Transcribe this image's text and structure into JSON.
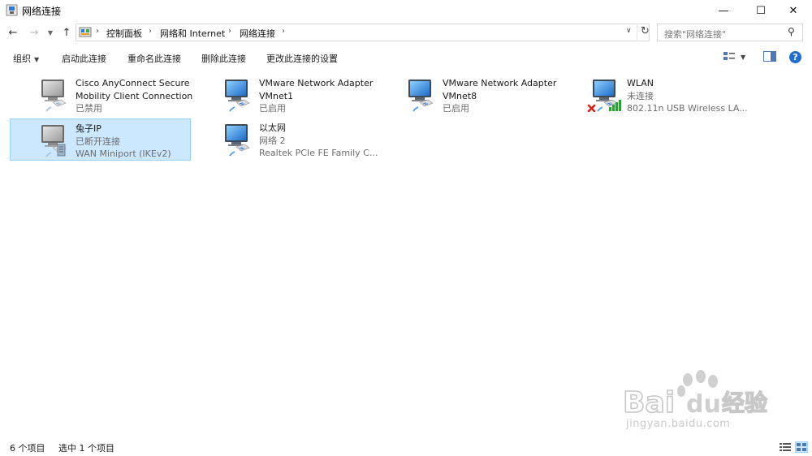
{
  "window": {
    "title": "网络连接",
    "minimize_glyph": "—",
    "maximize_glyph": "☐",
    "close_glyph": "✕"
  },
  "nav": {
    "back_glyph": "←",
    "forward_glyph": "→",
    "recent_glyph": "▼",
    "up_glyph": "↑"
  },
  "address": {
    "crumbs": [
      "控制面板",
      "网络和 Internet",
      "网络连接"
    ],
    "separator": "›",
    "dropdown_glyph": "∨",
    "refresh_glyph": "↻"
  },
  "search": {
    "placeholder": "搜索\"网络连接\"",
    "icon": "search-icon"
  },
  "toolbar": {
    "organize": "组织",
    "organize_caret": "▼",
    "enable": "启动此连接",
    "rename": "重命名此连接",
    "delete": "删除此连接",
    "change_settings": "更改此连接的设置",
    "view_caret": "▼",
    "help": "?"
  },
  "items": [
    {
      "name": "Cisco AnyConnect Secure",
      "name2": "Mobility Client Connection",
      "status": "已禁用",
      "device": "",
      "icon": "network-adapter-icon",
      "selected": false
    },
    {
      "name": "VMware Network Adapter",
      "name2": "",
      "status": "VMnet1",
      "device": "已启用",
      "icon": "network-adapter-icon",
      "selected": false
    },
    {
      "name": "VMware Network Adapter",
      "name2": "",
      "status": "VMnet8",
      "device": "已启用",
      "icon": "network-adapter-icon",
      "selected": false
    },
    {
      "name": "WLAN",
      "name2": "",
      "status": "未连接",
      "device": "802.11n USB Wireless LA...",
      "icon": "wireless-adapter-icon",
      "selected": false
    },
    {
      "name": "兔子IP",
      "name2": "",
      "status": "已断开连接",
      "device": "WAN Miniport (IKEv2)",
      "icon": "vpn-connection-icon",
      "selected": true
    },
    {
      "name": "以太网",
      "name2": "",
      "status": "网络 2",
      "device": "Realtek PCIe FE Family C...",
      "icon": "network-adapter-icon",
      "selected": false
    }
  ],
  "statusbar": {
    "count": "6 个项目",
    "selected": "选中 1 个项目"
  },
  "watermark": {
    "logo": "Bai du 经验",
    "url": "jingyan.baidu.com"
  },
  "colors": {
    "selection_bg": "#cce8ff",
    "selection_border": "#99d1ff",
    "accent": "#1f6fd1",
    "error_red": "#d9211c",
    "signal_green": "#2f9e3a"
  }
}
